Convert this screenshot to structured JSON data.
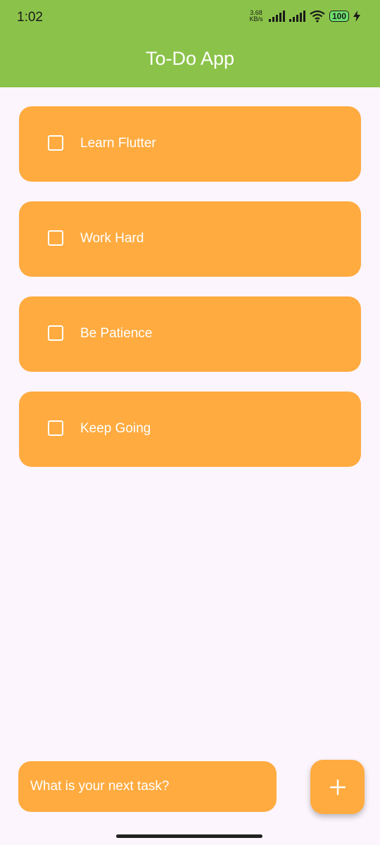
{
  "status_bar": {
    "time": "1:02",
    "net_speed_value": "3.68",
    "net_speed_unit": "KB/s",
    "battery": "100"
  },
  "app_bar": {
    "title": "To-Do App",
    "color": "#8BC34A"
  },
  "tasks": [
    {
      "label": "Learn Flutter",
      "checked": false
    },
    {
      "label": "Work Hard",
      "checked": false
    },
    {
      "label": "Be Patience",
      "checked": false
    },
    {
      "label": "Keep Going",
      "checked": false
    }
  ],
  "new_task": {
    "placeholder": "What is your next task?",
    "value": ""
  },
  "add_button": {
    "icon": "plus-icon"
  },
  "colors": {
    "accent": "#FFAB40",
    "background": "#FCF5FD"
  }
}
